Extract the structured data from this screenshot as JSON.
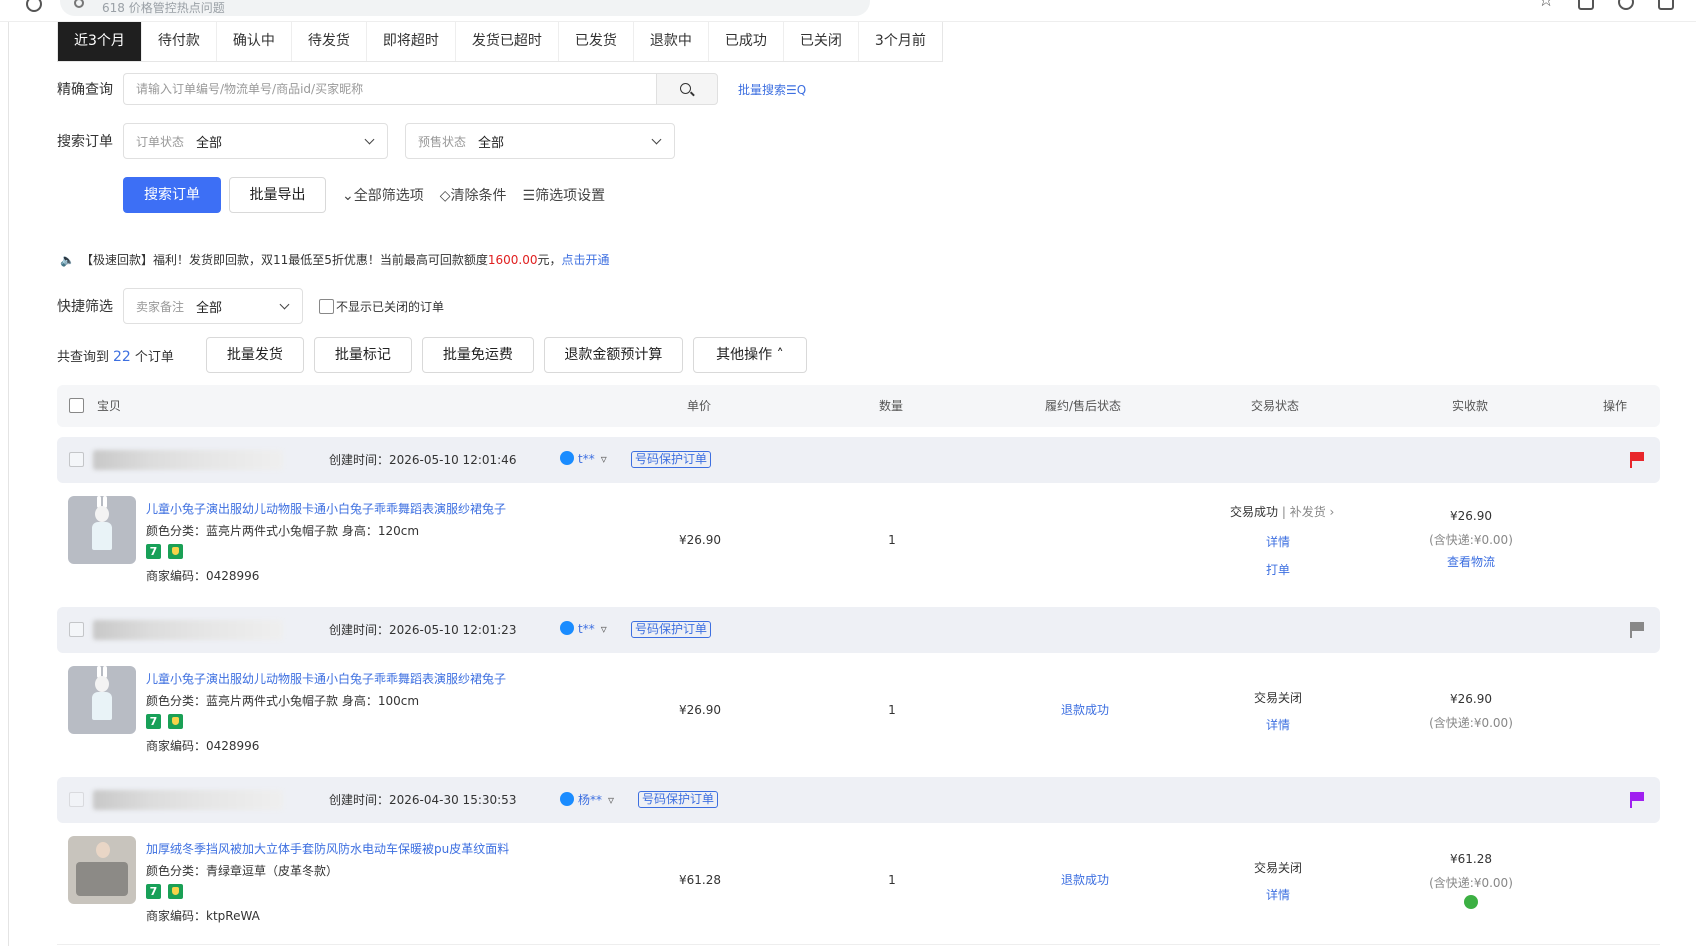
{
  "browser": {
    "search_placeholder": "618 价格管控热点问题"
  },
  "tabs": [
    {
      "label": "近3个月"
    },
    {
      "label": "待付款"
    },
    {
      "label": "确认中"
    },
    {
      "label": "待发货"
    },
    {
      "label": "即将超时"
    },
    {
      "label": "发货已超时"
    },
    {
      "label": "已发货"
    },
    {
      "label": "退款中"
    },
    {
      "label": "已成功"
    },
    {
      "label": "已关闭"
    },
    {
      "label": "3个月前"
    }
  ],
  "precise_search": {
    "label": "精确查询",
    "placeholder": "请输入订单编号/物流单号/商品id/买家昵称",
    "bulk_link": "批量搜索☰Q"
  },
  "search_orders": {
    "label": "搜索订单",
    "order_status_label": "订单状态",
    "order_status_value": "全部",
    "presale_label": "预售状态",
    "presale_value": "全部"
  },
  "actions": {
    "search_btn": "搜索订单",
    "export_btn": "批量导出",
    "all_filters": "⌄全部筛选项",
    "clear": "◇清除条件",
    "filter_settings": "☰筛选项设置"
  },
  "notice": {
    "prefix": "【极速回款】福利！发货即回款，双11最低至5折优惠！当前最高可回款额度",
    "amount": "1600.00",
    "suffix": "元，",
    "link": "点击开通"
  },
  "quick_filter": {
    "label": "快捷筛选",
    "remark_label": "卖家备注",
    "remark_value": "全部",
    "hide_closed": "不显示已关闭的订单"
  },
  "summary": {
    "prefix": "共查询到",
    "count": "22",
    "suffix": "个订单",
    "buttons": [
      "批量发货",
      "批量标记",
      "批量免运费",
      "退款金额预计算",
      "其他操作 ˄"
    ]
  },
  "table_headers": {
    "item": "宝贝",
    "price": "单价",
    "qty": "数量",
    "fulfil": "履约/售后状态",
    "trade": "交易状态",
    "paid": "实收款",
    "ops": "操作"
  },
  "colors": {
    "primary": "#3d6ff5",
    "link": "#3d6fe0",
    "flag_red": "#e8262b",
    "flag_grey": "#888888",
    "flag_purple": "#a020f0"
  },
  "orders": [
    {
      "created": "创建时间：2026-05-10 12:01:46",
      "buyer": "t**",
      "tag": "号码保护订单",
      "flag": "red",
      "title": "儿童小兔子演出服幼儿动物服卡通小白兔子乖乖舞蹈表演服纱裙兔子",
      "spec": "颜色分类：蓝亮片两件式小兔帽子款  身高：120cm",
      "code": "商家编码：0428996",
      "price": "¥26.90",
      "qty": "1",
      "fulfil": "",
      "trade_status": "交易成功",
      "trade_extra": " | 补发货 ›",
      "trade_links": [
        "详情",
        "打单"
      ],
      "paid": "¥26.90",
      "shipping": "(含快递:¥0.00)",
      "paid_link": "查看物流"
    },
    {
      "created": "创建时间：2026-05-10 12:01:23",
      "buyer": "t**",
      "tag": "号码保护订单",
      "flag": "grey",
      "title": "儿童小兔子演出服幼儿动物服卡通小白兔子乖乖舞蹈表演服纱裙兔子",
      "spec": "颜色分类：蓝亮片两件式小兔帽子款  身高：100cm",
      "code": "商家编码：0428996",
      "price": "¥26.90",
      "qty": "1",
      "fulfil": "退款成功",
      "trade_status": "交易关闭",
      "trade_extra": "",
      "trade_links": [
        "详情"
      ],
      "paid": "¥26.90",
      "shipping": "(含快递:¥0.00)",
      "paid_link": ""
    },
    {
      "created": "创建时间：2026-04-30 15:30:53",
      "buyer": "杨**",
      "tag": "号码保护订单",
      "flag": "purple",
      "title": "加厚绒冬季挡风被加大立体手套防风防水电动车保暖被pu皮革纹面料",
      "spec": "颜色分类：青绿章逗草（皮革冬款）",
      "code": "商家编码：ktpReWA",
      "price": "¥61.28",
      "qty": "1",
      "fulfil": "退款成功",
      "trade_status": "交易关闭",
      "trade_extra": "",
      "trade_links": [
        "详情"
      ],
      "paid": "¥61.28",
      "shipping": "(含快递:¥0.00)",
      "paid_link": ""
    }
  ]
}
